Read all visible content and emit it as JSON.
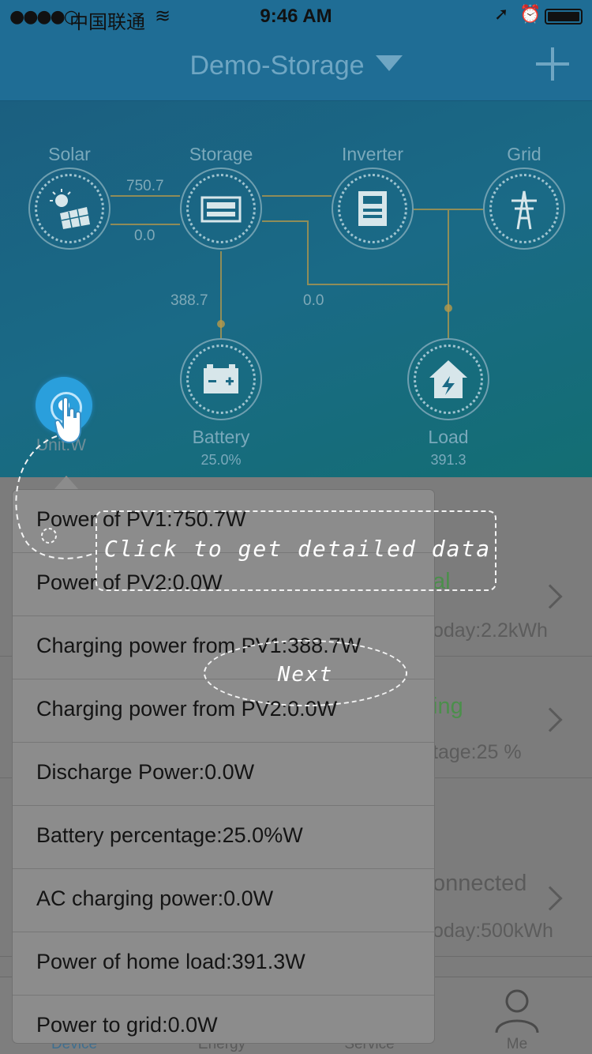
{
  "status_bar": {
    "signal": "●●●●○",
    "carrier": "中国联通",
    "time": "9:46 AM"
  },
  "header": {
    "title": "Demo-Storage"
  },
  "flow": {
    "nodes": {
      "solar": "Solar",
      "storage": "Storage",
      "inverter": "Inverter",
      "grid": "Grid",
      "battery": "Battery",
      "battery_value": "25.0%",
      "load": "Load",
      "load_value": "391.3"
    },
    "values": {
      "solar_to_storage_top": "750.7",
      "solar_to_storage_bottom": "0.0",
      "storage_to_battery": "388.7",
      "inverter_to_load": "0.0"
    },
    "unit_label": "Unit:W"
  },
  "background_list": {
    "row1_title_fragment": "al",
    "row1_sub": "oday:2.2kWh",
    "row2_title_fragment": "ing",
    "row2_sub": "tage:25 %",
    "row3_title_fragment": "onnected",
    "row3_sub": "oday:500kWh"
  },
  "tabs": {
    "device": "Device",
    "energy": "Energy",
    "service": "Service",
    "me": "Me"
  },
  "popup": {
    "rows": [
      "Power of PV1:750.7W",
      "Power of PV2:0.0W",
      "Charging power from PV1:388.7W",
      "Charging power from PV2:0.0W",
      "Discharge Power:0.0W",
      "Battery percentage:25.0%W",
      "AC charging power:0.0W",
      "Power of home load:391.3W",
      "Power to grid:0.0W"
    ]
  },
  "guide": {
    "tooltip": "Click to get detailed data",
    "next_label": "Next"
  },
  "colors": {
    "accent_blue": "#2a9fdc",
    "header_bg": "#1f6d95",
    "flow_line": "#c9a44a",
    "green_status": "#4b8f4b"
  }
}
